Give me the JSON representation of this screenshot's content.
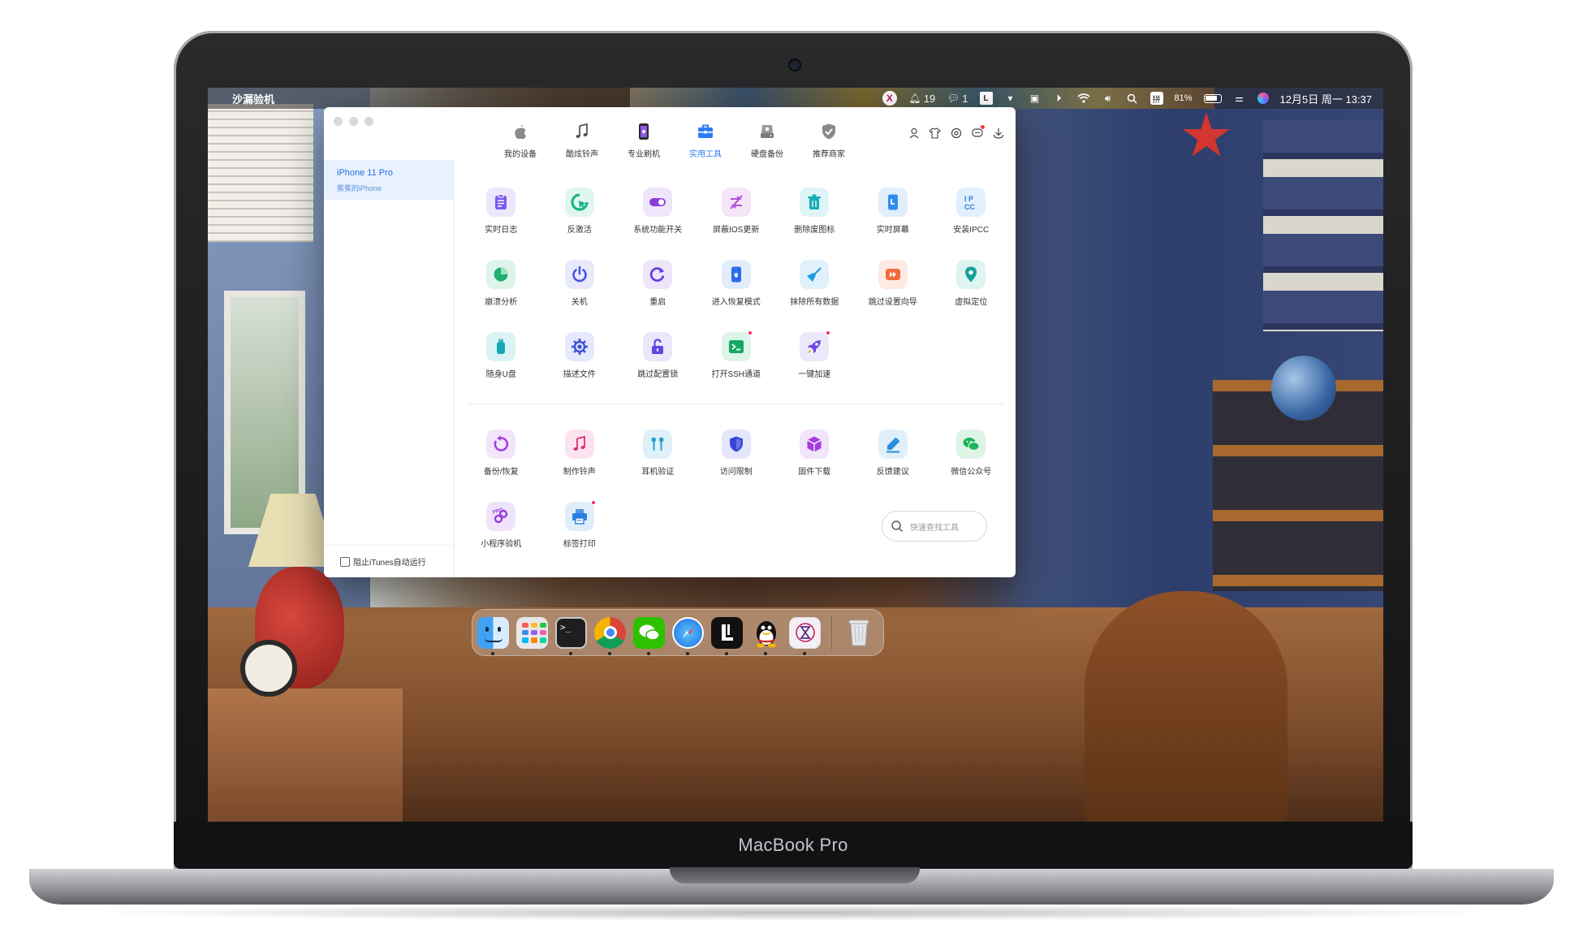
{
  "device_label": "MacBook Pro",
  "menubar": {
    "app_name": "沙漏验机",
    "status": {
      "notifications_count": "19",
      "wechat_count": "1",
      "input_method": "拼",
      "battery": "81%",
      "datetime": "12月5日 周一 13:37"
    }
  },
  "app": {
    "nav_tabs": [
      {
        "label": "我的设备",
        "icon": "apple-icon",
        "active": false
      },
      {
        "label": "酷炫铃声",
        "icon": "music-note-icon",
        "active": false
      },
      {
        "label": "专业刷机",
        "icon": "phone-flash-icon",
        "active": false
      },
      {
        "label": "实用工具",
        "icon": "toolbox-icon",
        "active": true
      },
      {
        "label": "硬盘备份",
        "icon": "disk-backup-icon",
        "active": false
      },
      {
        "label": "推荐商家",
        "icon": "shield-check-icon",
        "active": false
      }
    ],
    "tray_icons": [
      "user-icon",
      "shirt-icon",
      "settings-circle-icon",
      "message-icon",
      "download-icon"
    ],
    "sidebar": {
      "device_name": "iPhone 11 Pro",
      "device_sub": "蕉蕉的iPhone",
      "itunes_label": "阻止iTunes自动运行"
    },
    "tools_primary": [
      {
        "label": "实时日志",
        "icon": "clipboard-log-icon",
        "bg": "#ece8fb",
        "fg": "#7a5af0"
      },
      {
        "label": "反激活",
        "icon": "cursor-refresh-icon",
        "bg": "#e2f6f0",
        "fg": "#17b68c"
      },
      {
        "label": "系统功能开关",
        "icon": "toggle-icon",
        "bg": "#efe6fb",
        "fg": "#8a3cd8"
      },
      {
        "label": "屏蔽IOS更新",
        "icon": "block-update-icon",
        "bg": "#f4e5f8",
        "fg": "#b34fd6"
      },
      {
        "label": "删除废图标",
        "icon": "trash-icon",
        "bg": "#dff4f6",
        "fg": "#14aeb8"
      },
      {
        "label": "实时屏幕",
        "icon": "live-screen-icon",
        "bg": "#e1eefc",
        "fg": "#2f8cf0"
      },
      {
        "label": "安装IPCC",
        "icon": "ipcc-icon",
        "bg": "#e2effc",
        "fg": "#2a7fd8"
      },
      {
        "label": "崩溃分析",
        "icon": "pie-chart-icon",
        "bg": "#def4ea",
        "fg": "#1fb06f"
      },
      {
        "label": "关机",
        "icon": "power-icon",
        "bg": "#e8eafc",
        "fg": "#4a52e0"
      },
      {
        "label": "重启",
        "icon": "restart-icon",
        "bg": "#ede6fb",
        "fg": "#6a3fe0"
      },
      {
        "label": "进入恢复模式",
        "icon": "recovery-phone-icon",
        "bg": "#e3ecfc",
        "fg": "#2c6be8"
      },
      {
        "label": "抹除所有数据",
        "icon": "broom-icon",
        "bg": "#e0f1fb",
        "fg": "#1f9be0"
      },
      {
        "label": "跳过设置向导",
        "icon": "skip-forward-icon",
        "bg": "#fdeae3",
        "fg": "#f26a3a"
      },
      {
        "label": "虚拟定位",
        "icon": "location-pin-icon",
        "bg": "#dff3f1",
        "fg": "#13a39a"
      },
      {
        "label": "随身U盘",
        "icon": "usb-drive-icon",
        "bg": "#dcf3f4",
        "fg": "#14a8b4"
      },
      {
        "label": "描述文件",
        "icon": "gear-profile-icon",
        "bg": "#e5e9fb",
        "fg": "#3f4fd8"
      },
      {
        "label": "跳过配置锁",
        "icon": "unlock-icon",
        "bg": "#ebe6fb",
        "fg": "#6246e2"
      },
      {
        "label": "打开SSH通道",
        "icon": "terminal-icon",
        "bg": "#ddf4e8",
        "fg": "#16a865",
        "dot": true
      },
      {
        "label": "一键加速",
        "icon": "rocket-icon",
        "bg": "#ece8fb",
        "fg": "#6a4ae6",
        "dot": true
      }
    ],
    "tools_secondary": [
      {
        "label": "备份/恢复",
        "icon": "backup-restore-icon",
        "bg": "#f2e5fa",
        "fg": "#a53fe0"
      },
      {
        "label": "制作铃声",
        "icon": "music-note-icon",
        "bg": "#fbe4ef",
        "fg": "#e02a78"
      },
      {
        "label": "耳机验证",
        "icon": "earbuds-icon",
        "bg": "#dff1f8",
        "fg": "#2b9ccc"
      },
      {
        "label": "访问限制",
        "icon": "shield-icon",
        "bg": "#e4e6fb",
        "fg": "#3a46d8"
      },
      {
        "label": "固件下载",
        "icon": "cube-icon",
        "bg": "#f2e4fb",
        "fg": "#a43ce0"
      },
      {
        "label": "反馈建议",
        "icon": "edit-icon",
        "bg": "#e0f0fb",
        "fg": "#2a8ed8"
      },
      {
        "label": "微信公众号",
        "icon": "wechat-icon",
        "bg": "#ddf4e6",
        "fg": "#1eb45a"
      },
      {
        "label": "小程序验机",
        "icon": "mini-program-pro-icon",
        "bg": "#f0e4fb",
        "fg": "#9a3ce0"
      },
      {
        "label": "标签打印",
        "icon": "printer-icon",
        "bg": "#e0edfb",
        "fg": "#2c7ee0",
        "dot": true
      }
    ],
    "search_placeholder": "快速查找工具"
  },
  "dock": [
    {
      "name": "finder",
      "running": true
    },
    {
      "name": "launchpad",
      "running": false
    },
    {
      "name": "terminal",
      "running": true
    },
    {
      "name": "chrome",
      "running": true
    },
    {
      "name": "wechat",
      "running": true
    },
    {
      "name": "safari",
      "running": true
    },
    {
      "name": "l-app",
      "running": true
    },
    {
      "name": "qq",
      "running": true
    },
    {
      "name": "hourglass-app",
      "running": true
    },
    {
      "name": "trash",
      "running": false
    }
  ]
}
